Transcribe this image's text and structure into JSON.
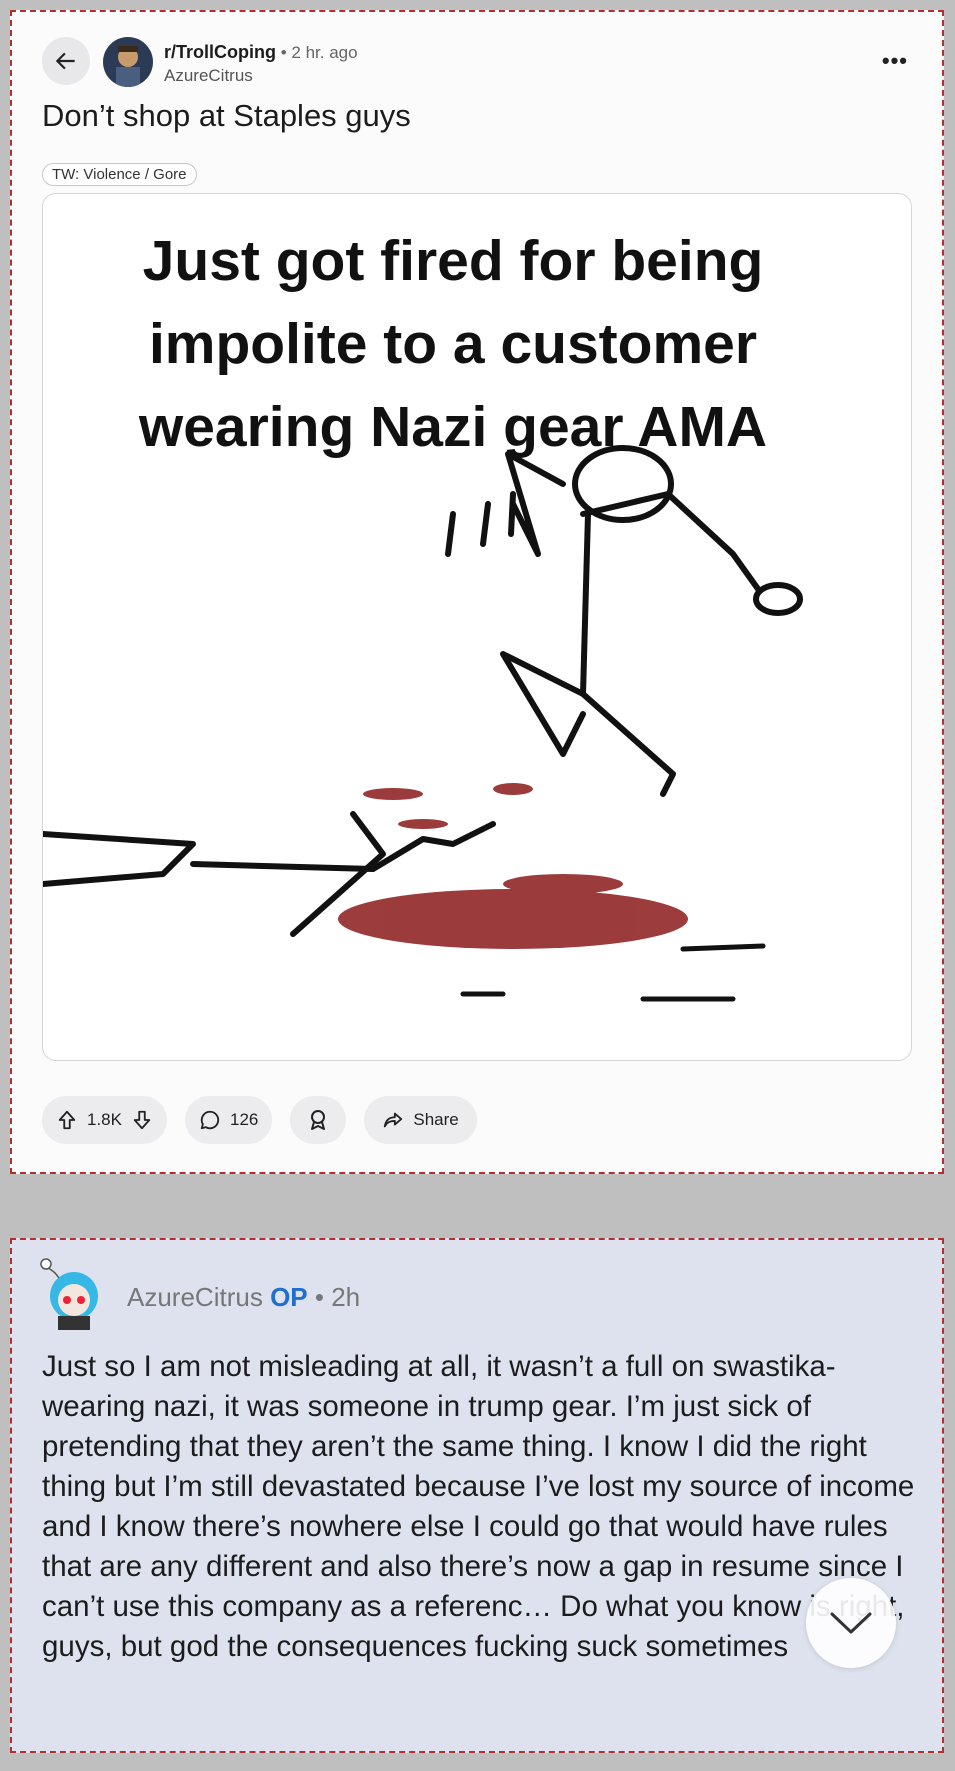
{
  "post": {
    "subreddit": "r/TrollCoping",
    "age": " • 2 hr. ago",
    "author": "AzureCitrus",
    "title": "Don’t shop at Staples guys",
    "flair": "TW: Violence / Gore",
    "image_text": [
      "Just got fired for being",
      "impolite to a customer",
      "wearing Nazi gear AMA"
    ],
    "votes": "1.8K",
    "comments": "126",
    "share_label": "Share",
    "icons": [
      "back-arrow-icon",
      "more-icon",
      "upvote-icon",
      "downvote-icon",
      "comment-icon",
      "award-icon",
      "share-icon"
    ]
  },
  "comment": {
    "author": "AzureCitrus",
    "op_badge": "OP",
    "age": " • 2h",
    "body": "Just so I am not misleading at all, it wasn’t a full on swastika-wearing nazi, it was someone in trump gear. I’m just sick of pretending that they aren’t the same thing. I know I did the right thing but I’m still devastated because I’ve lost my source of income and I know there’s nowhere else I could go that would have rules that are any different and also there’s now a gap in resume since I can’t use this company as a referenc… Do what you know is right, guys, but god the consequences fucking suck sometimes"
  },
  "colors": {
    "op": "#1e6fd0",
    "comment_bg": "#dde2ee",
    "blood": "#8b1a1a"
  }
}
